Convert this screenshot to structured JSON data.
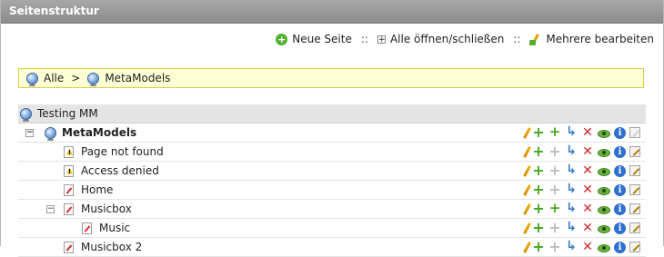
{
  "panel": {
    "title": "Seitenstruktur"
  },
  "toolbar": {
    "new_page": "Neue Seite",
    "sep1": "::",
    "toggle_all": "Alle öffnen/schließen",
    "sep2": "::",
    "edit_multiple": "Mehrere bearbeiten"
  },
  "breadcrumb": {
    "all": "Alle",
    "separator": ">",
    "current": "MetaModels"
  },
  "tree": {
    "root": "Testing MM",
    "rows": [
      {
        "label": "MetaModels",
        "icon": "globe-icon",
        "toggle": "−",
        "bold": true
      },
      {
        "label": "Page not found",
        "icon": "page-warning-icon"
      },
      {
        "label": "Access denied",
        "icon": "page-warning-icon"
      },
      {
        "label": "Home",
        "icon": "page-icon"
      },
      {
        "label": "Musicbox",
        "icon": "page-icon",
        "toggle": "−"
      },
      {
        "label": "Music",
        "icon": "page-icon"
      },
      {
        "label": "Musicbox 2",
        "icon": "page-icon"
      }
    ]
  },
  "colors": {
    "header_bg": "#9a9a9a",
    "breadcrumb_bg": "#ffffd5",
    "breadcrumb_border": "#d8cc4a",
    "add_green": "#46a623",
    "delete_red": "#d42a2a"
  }
}
